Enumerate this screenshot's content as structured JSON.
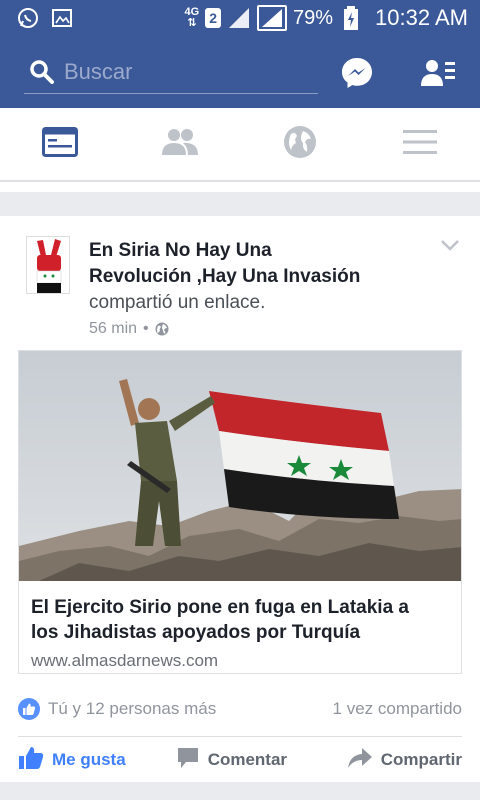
{
  "status_bar": {
    "network_type": "4G",
    "sim_slot": "2",
    "battery_percent": "79%",
    "time": "10:32 AM",
    "icons": [
      "whatsapp-icon",
      "gallery-notification-icon",
      "signal-icon",
      "signal-icon",
      "battery-charging-icon"
    ]
  },
  "search": {
    "placeholder": "Buscar"
  },
  "nav": {
    "tabs": [
      {
        "name": "news-feed-icon",
        "active": true
      },
      {
        "name": "friends-icon",
        "active": false
      },
      {
        "name": "notifications-globe-icon",
        "active": false
      },
      {
        "name": "menu-icon",
        "active": false
      }
    ]
  },
  "post": {
    "page_name_line1": "En Siria No Hay Una",
    "page_name_line2": "Revolución ,Hay Una Invasión",
    "action": "compartió un enlace.",
    "time": "56 min",
    "separator": "•",
    "link": {
      "title_line1": "El Ejercito Sirio pone en fuga en Latakia a",
      "title_line2": "los Jihadistas apoyados por Turquía",
      "domain": "www.almasdarnews.com"
    },
    "reactions": "Tú y 12 personas más",
    "shares": "1 vez compartido",
    "actions": {
      "like": "Me gusta",
      "comment": "Comentar",
      "share": "Compartir"
    }
  },
  "colors": {
    "brand": "#3b5998",
    "like_blue": "#4080ff",
    "background": "#e9ebee"
  }
}
